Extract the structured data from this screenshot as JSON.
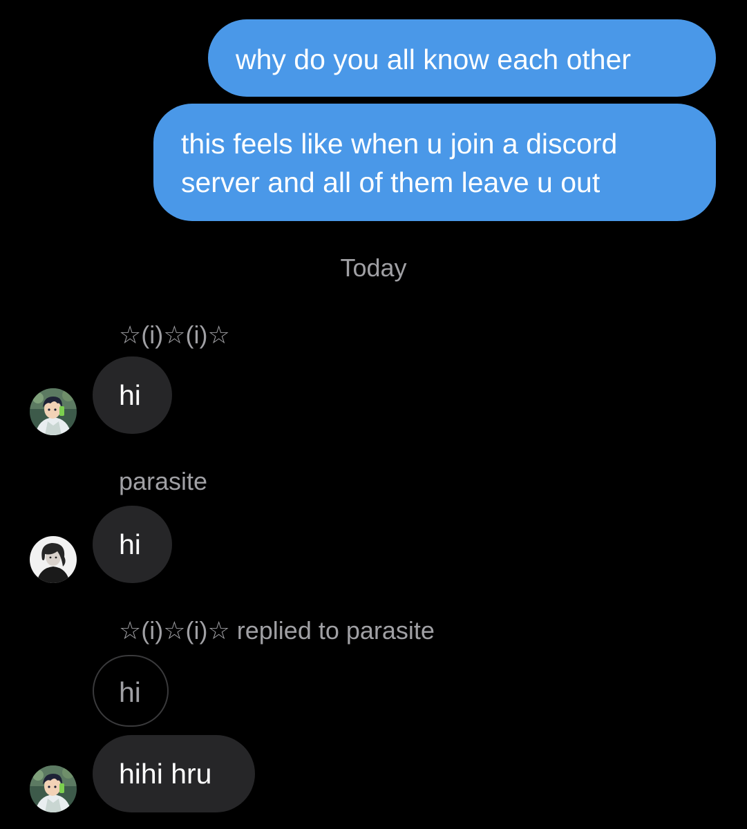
{
  "conversation": {
    "outgoing_color": "#4a98e8",
    "incoming_color": "#262628",
    "outgoing": [
      {
        "text": "why do you all know each other"
      },
      {
        "lines": [
          "this feels like when u join a discord",
          "server and all of them leave u out"
        ]
      }
    ],
    "date_divider": "Today",
    "groups": [
      {
        "sender": "☆(i)☆(i)☆",
        "avatar_icon": "anime-boy-avatar-icon",
        "message": "hi"
      },
      {
        "sender": "parasite",
        "avatar_icon": "portrait-avatar-icon",
        "message": "hi"
      },
      {
        "reply_header": "☆(i)☆(i)☆ replied to parasite",
        "quoted_message": "hi",
        "avatar_icon": "anime-boy-avatar-icon",
        "message": "hihi hru"
      }
    ]
  }
}
